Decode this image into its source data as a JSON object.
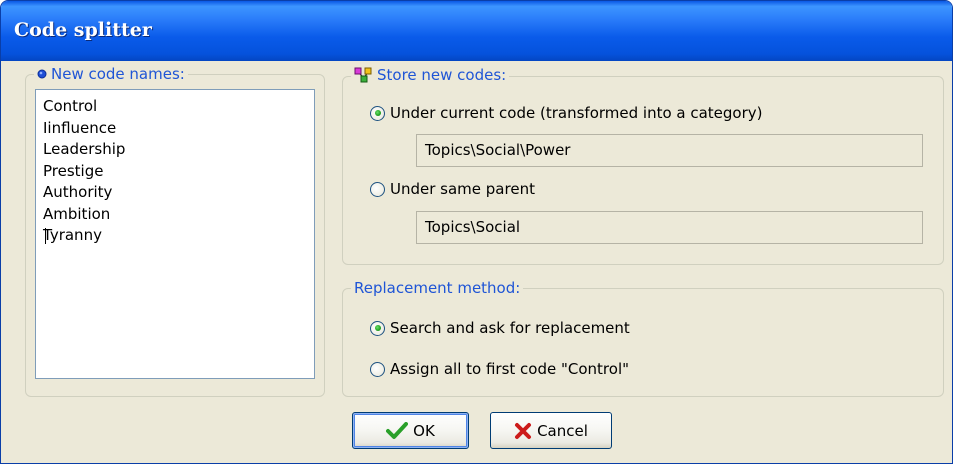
{
  "window": {
    "title": "Code splitter"
  },
  "new_codes": {
    "legend": "New code names:",
    "items": [
      "Control",
      "Iinfluence",
      "Leadership",
      "Prestige",
      "Authority",
      "Ambition",
      "Tyranny"
    ]
  },
  "store": {
    "legend": "Store new codes:",
    "option1_label": "Under current code (transformed into a category)",
    "option1_path": "Topics\\Social\\Power",
    "option2_label": "Under same parent",
    "option2_path": "Topics\\Social",
    "selected": "option1"
  },
  "replacement": {
    "legend": "Replacement method:",
    "option1_label": "Search and ask for replacement",
    "option2_label": "Assign all to first code \"Control\"",
    "selected": "option1"
  },
  "buttons": {
    "ok_label": "OK",
    "cancel_label": "Cancel"
  },
  "colors": {
    "legend_text": "#1f55d6",
    "title_bar": "#0a5bea",
    "ok_check": "#2aa02a",
    "cancel_x": "#cc1b1b"
  },
  "icons": {
    "new_codes_legend": "blue-bullet-icon",
    "store_legend": "code-tree-icon",
    "ok": "checkmark-icon",
    "cancel": "x-icon"
  }
}
